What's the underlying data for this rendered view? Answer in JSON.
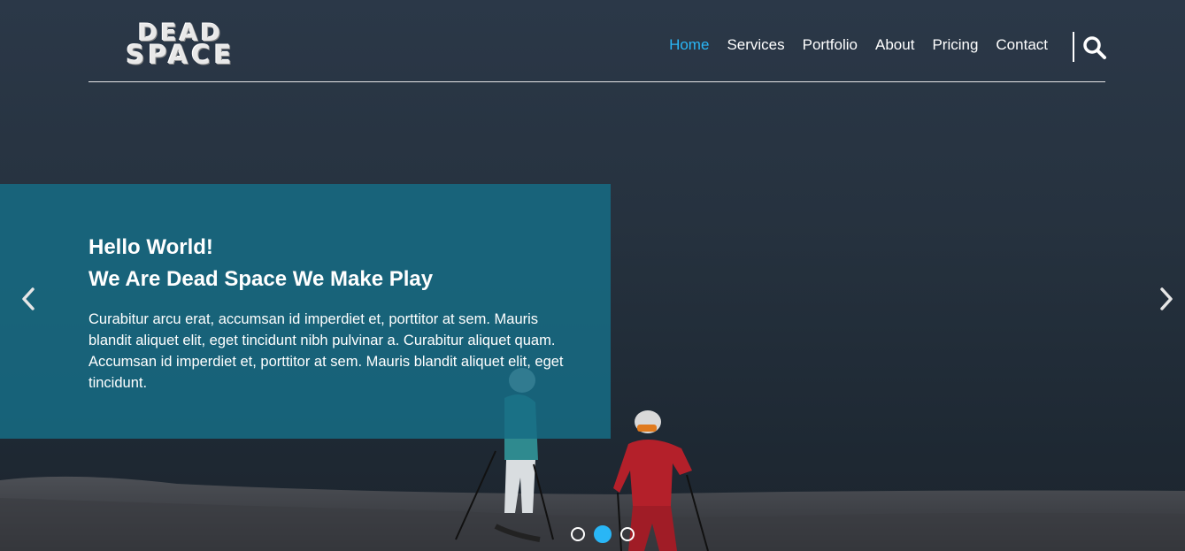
{
  "logo": {
    "line1": "DEAD",
    "line2": "SPACE"
  },
  "nav": {
    "items": [
      "Home",
      "Services",
      "Portfolio",
      "About",
      "Pricing",
      "Contact"
    ],
    "active": "Home"
  },
  "header": {
    "search_icon": "search-icon"
  },
  "slide": {
    "title_line1": "Hello World!",
    "title_line2": "We Are Dead Space We Make Play",
    "body": "Curabitur arcu erat, accumsan id imperdiet et, porttitor at sem. Mauris blandit aliquet elit, eget tincidunt nibh pulvinar a. Curabitur aliquet quam. Accumsan id imperdiet et, porttitor at sem. Mauris blandit aliquet elit, eget tincidunt."
  },
  "carousel": {
    "prev_icon": "chevron-left-icon",
    "next_icon": "chevron-right-icon",
    "slide_count": 3,
    "active_index": 1
  },
  "colors": {
    "accent": "#29b6f6",
    "caption_bg": "#166c85",
    "background": "#26323f"
  }
}
